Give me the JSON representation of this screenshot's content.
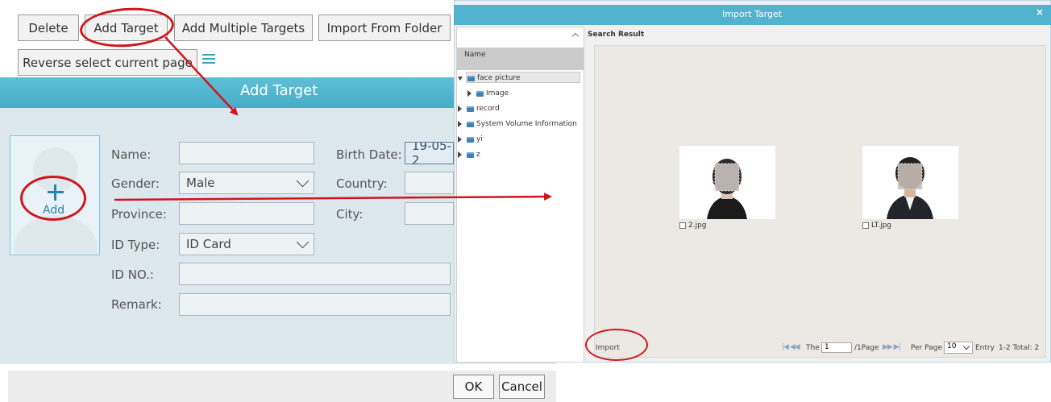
{
  "toolbar": {
    "delete": "Delete",
    "add_target": "Add Target",
    "add_multiple": "Add Multiple Targets",
    "import_folder": "Import From Folder",
    "reverse_select": "Reverse select current page"
  },
  "form": {
    "title": "Add Target",
    "add_photo": "Add",
    "name_label": "Name:",
    "gender_label": "Gender:",
    "gender_value": "Male",
    "province_label": "Province:",
    "id_type_label": "ID Type:",
    "id_type_value": "ID Card",
    "id_no_label": "ID NO.:",
    "remark_label": "Remark:",
    "birth_label": "Birth Date:",
    "birth_value": "19-05-2",
    "country_label": "Country:",
    "city_label": "City:",
    "ok": "OK",
    "cancel": "Cancel"
  },
  "dialog": {
    "title": "Import Target",
    "close": "×",
    "tree_header": "Name",
    "tree": [
      {
        "label": "face picture",
        "level": 0,
        "open": true
      },
      {
        "label": "Image",
        "level": 1,
        "open": false
      },
      {
        "label": "record",
        "level": 0,
        "open": false
      },
      {
        "label": "System Volume Information",
        "level": 0,
        "open": false
      },
      {
        "label": "yi",
        "level": 0,
        "open": false
      },
      {
        "label": "z",
        "level": 0,
        "open": false
      }
    ],
    "search_result": "Search Result",
    "files": [
      {
        "name": "2.jpg",
        "suit": "#1b1b1b"
      },
      {
        "name": "LT.jpg",
        "suit": "#22262b"
      }
    ],
    "import": "Import",
    "pager": {
      "the": "The",
      "page_value": "1",
      "page_suffix": "/1Page",
      "per_page": "Per Page",
      "per_page_value": "10",
      "entry": "Entry",
      "total": "1-2 Total: 2"
    }
  },
  "colors": {
    "accent": "#52b3cf",
    "annotation": "#d0161c",
    "form_bg": "#dce8ee"
  }
}
